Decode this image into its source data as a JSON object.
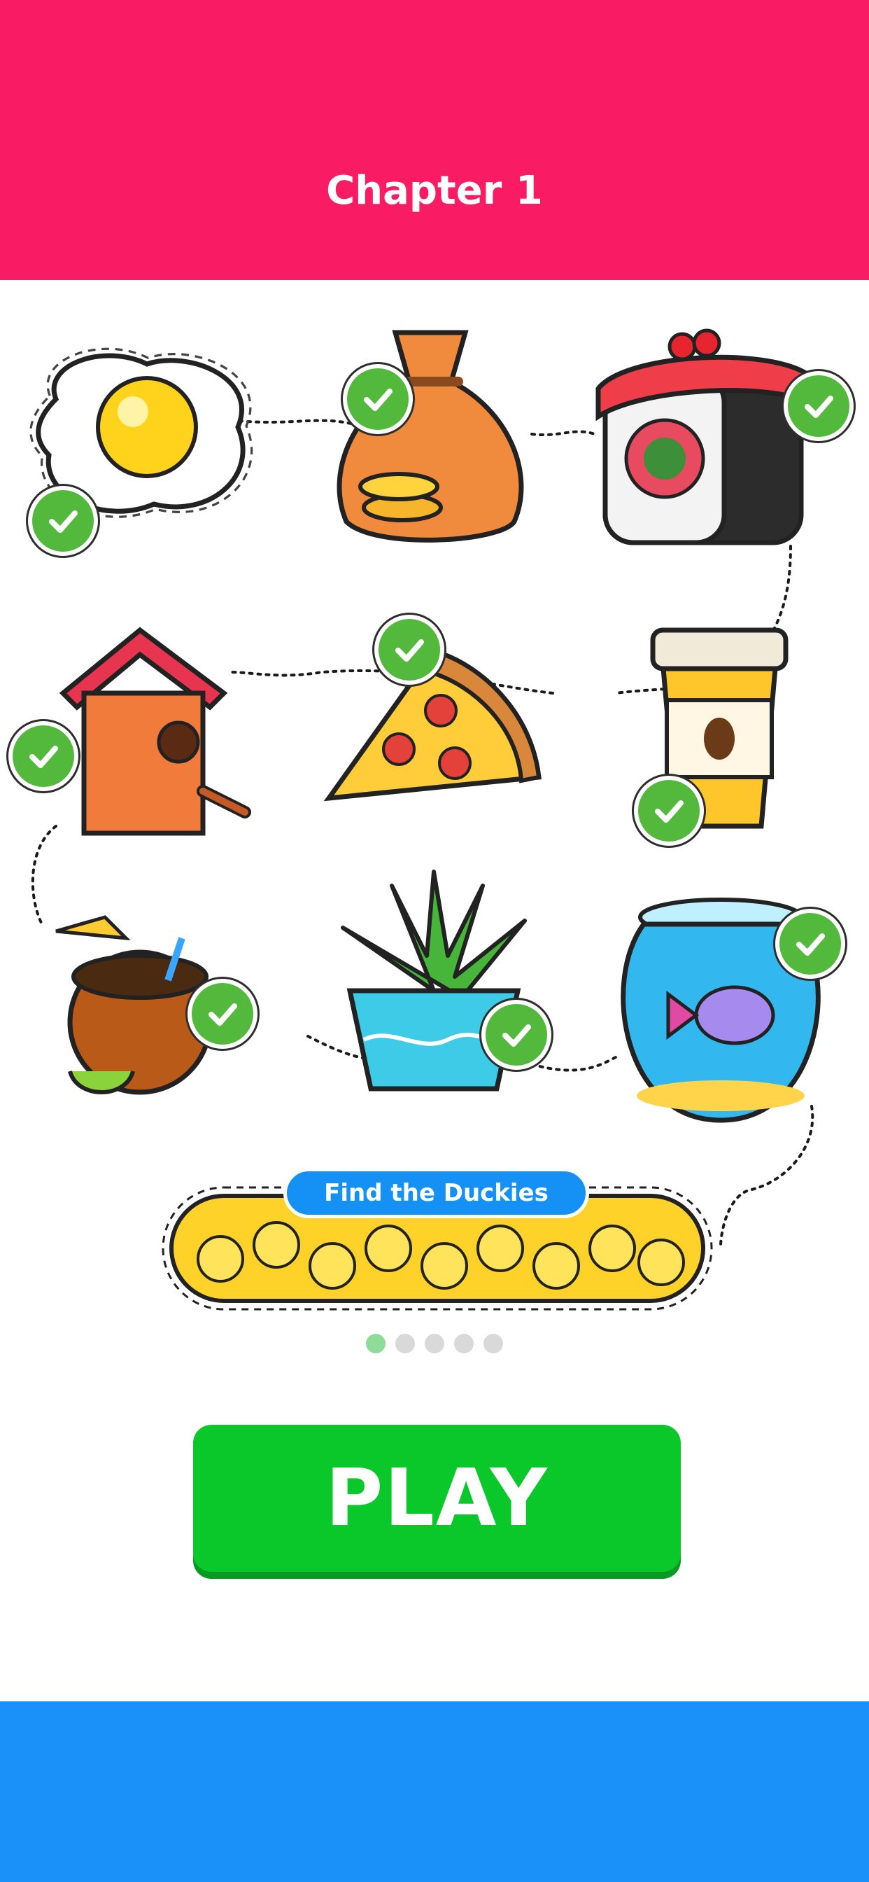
{
  "header": {
    "title": "Chapter 1",
    "color": "#f91b63"
  },
  "levels": [
    {
      "name": "egg",
      "completed": true
    },
    {
      "name": "money-bag",
      "completed": true
    },
    {
      "name": "sushi-roll",
      "completed": true
    },
    {
      "name": "birdhouse",
      "completed": true
    },
    {
      "name": "pizza-slice",
      "completed": true
    },
    {
      "name": "coffee-cup",
      "completed": true
    },
    {
      "name": "coconut-drink",
      "completed": true
    },
    {
      "name": "succulent-plant",
      "completed": true
    },
    {
      "name": "fish-bowl",
      "completed": true
    },
    {
      "name": "duckies-pile",
      "completed": false,
      "label": "Find the Duckies"
    }
  ],
  "pagination": {
    "pages": 5,
    "current": 1
  },
  "play_button": {
    "label": "PLAY",
    "color": "#0ac82a"
  },
  "footer": {
    "color": "#1a90f9"
  },
  "icons": {
    "check": "check-icon"
  }
}
